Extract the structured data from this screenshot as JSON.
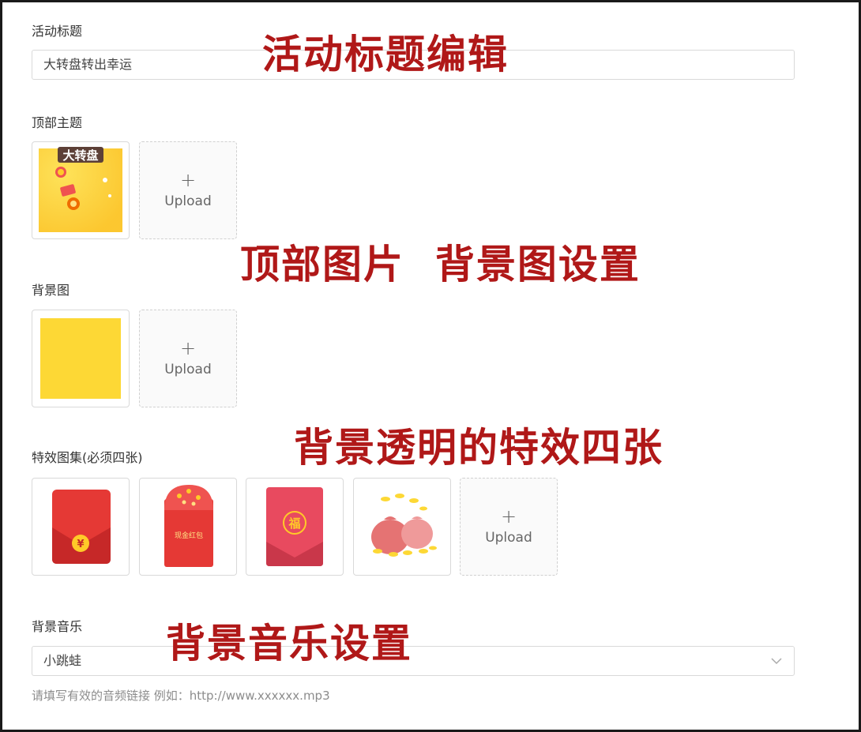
{
  "activity_title": {
    "label": "活动标题",
    "value": "大转盘转出幸运",
    "annotation": "活动标题编辑"
  },
  "top_theme": {
    "label": "顶部主题",
    "upload_label": "Upload",
    "thumb_text": "大转盘",
    "annotation": "顶部图片  背景图设置"
  },
  "background_image": {
    "label": "背景图",
    "upload_label": "Upload",
    "color": "#fdd835"
  },
  "effects": {
    "label": "特效图集(必须四张)",
    "upload_label": "Upload",
    "annotation": "背景透明的特效四张",
    "items": [
      {
        "name": "red-envelope-yen",
        "text": "¥"
      },
      {
        "name": "red-envelope-cash",
        "text": "现金红包"
      },
      {
        "name": "red-envelope-fu",
        "text": "福"
      },
      {
        "name": "money-bags",
        "text": ""
      }
    ]
  },
  "music": {
    "label": "背景音乐",
    "selected": "小跳蛙",
    "hint": "请填写有效的音频链接 例如：http://www.xxxxxx.mp3",
    "annotation": "背景音乐设置"
  },
  "colors": {
    "annotation": "#b01818",
    "accent_yellow": "#fdd835",
    "envelope_red": "#e53935"
  }
}
